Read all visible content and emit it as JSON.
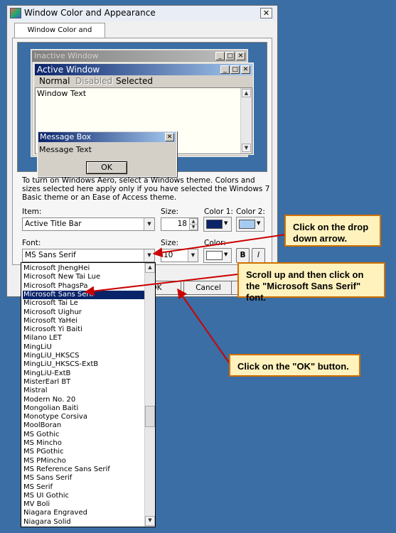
{
  "window": {
    "title": "Window Color and Appearance",
    "close_glyph": "✕"
  },
  "tab": {
    "label": "Window Color and Appearance"
  },
  "preview": {
    "inactive_title": "Inactive Window",
    "active_title": "Active Window",
    "menu": {
      "normal": "Normal",
      "disabled": "Disabled",
      "selected": "Selected"
    },
    "window_text": "Window Text",
    "message_box": {
      "title": "Message Box",
      "text": "Message Text",
      "ok": "OK"
    },
    "caption_buttons": {
      "minimize": "_",
      "maximize": "□",
      "close": "✕"
    }
  },
  "info_text": "To turn on Windows Aero, select a Windows theme.  Colors and sizes selected here apply only if you have selected the Windows 7 Basic theme or an Ease of Access theme.",
  "item": {
    "label": "Item:",
    "value": "Active Title Bar",
    "size_label": "Size:",
    "size_value": "18",
    "color1_label": "Color 1:",
    "color2_label": "Color 2:",
    "color1": "#0a246a",
    "color2": "#a6caf0"
  },
  "font": {
    "label": "Font:",
    "value": "MS Sans Serif",
    "size_label": "Size:",
    "size_value": "10",
    "color_label": "Color:",
    "color": "#ffffff",
    "bold": "B",
    "italic": "I"
  },
  "buttons": {
    "ok": "OK",
    "cancel": "Cancel"
  },
  "font_list": {
    "items": [
      "Microsoft JhengHei",
      "Microsoft New Tai Lue",
      "Microsoft PhagsPa",
      "Microsoft Sans Serif",
      "Microsoft Tai Le",
      "Microsoft Uighur",
      "Microsoft YaHei",
      "Microsoft Yi Baiti",
      "Milano LET",
      "MingLiU",
      "MingLiU_HKSCS",
      "MingLiU_HKSCS-ExtB",
      "MingLiU-ExtB",
      "MisterEarl BT",
      "Mistral",
      "Modern No. 20",
      "Mongolian Baiti",
      "Monotype Corsiva",
      "MoolBoran",
      "MS Gothic",
      "MS Mincho",
      "MS PGothic",
      "MS PMincho",
      "MS Reference Sans Serif",
      "MS Sans Serif",
      "MS Serif",
      "MS UI Gothic",
      "MV Boli",
      "Niagara Engraved",
      "Niagara Solid"
    ],
    "selected_index": 3,
    "scroll_position": 0.6
  },
  "callouts": {
    "dropdown": "Click on the drop down arrow.",
    "scroll": "Scroll up and then click on the \"Microsoft Sans Serif\" font.",
    "ok": "Click on the \"OK\" button."
  },
  "colors": {
    "desktop": "#3a6ea5",
    "arrow": "#cc0000",
    "callout_fill": "#fff2bd",
    "callout_border": "#d07000",
    "selection": "#0a246a"
  }
}
